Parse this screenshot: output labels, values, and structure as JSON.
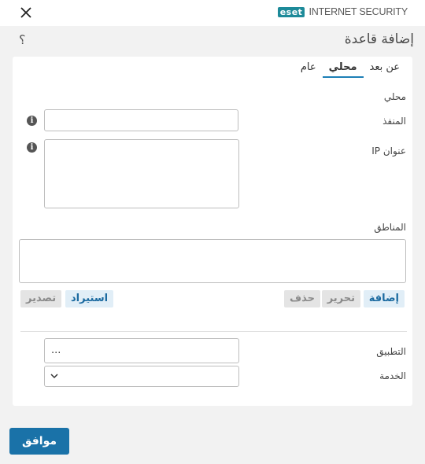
{
  "window": {
    "brand_logo": "eset",
    "brand_name": "INTERNET SECURITY",
    "close_icon": "close-icon"
  },
  "dialog": {
    "title": "إضافة قاعدة",
    "help": "؟"
  },
  "tabs": [
    {
      "label": "عام",
      "active": false
    },
    {
      "label": "محلي",
      "active": true
    },
    {
      "label": "عن بعد",
      "active": false
    }
  ],
  "local": {
    "section_label": "محلي",
    "port_label": "المنفذ",
    "port_value": "",
    "ip_label": "عنوان IP",
    "ip_value": "",
    "zones_label": "المناطق",
    "info_icon": "info-icon"
  },
  "zone_buttons": {
    "add": "إضافة",
    "edit": "تحرير",
    "delete": "حذف",
    "import": "استيراد",
    "export": "تصدير"
  },
  "app": {
    "label": "التطبيق",
    "value": "..."
  },
  "service": {
    "label": "الخدمة",
    "value": ""
  },
  "footer": {
    "ok": "موافق"
  },
  "colors": {
    "accent": "#1a72a8",
    "brand": "#1d8a99"
  }
}
